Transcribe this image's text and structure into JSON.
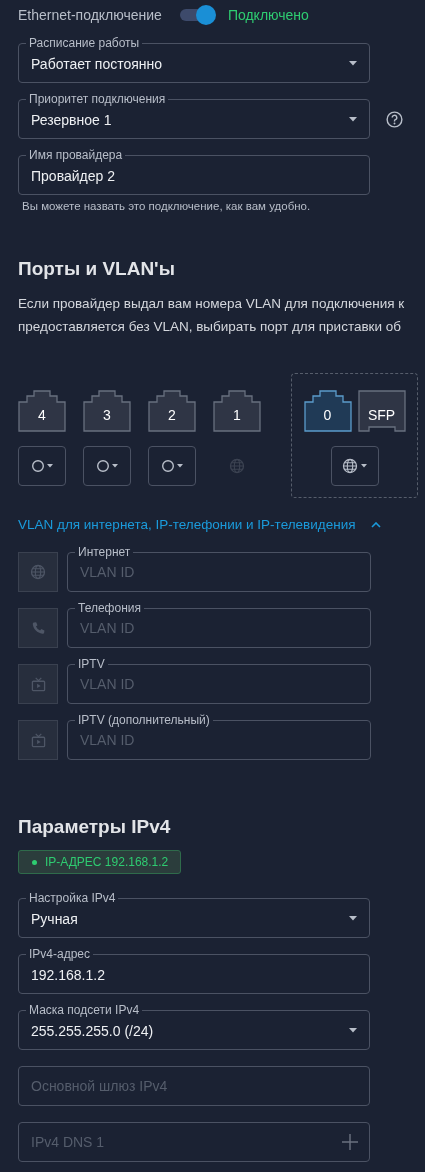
{
  "connection": {
    "label": "Ethernet-подключение",
    "on": true,
    "status": "Подключено"
  },
  "general_fields": [
    {
      "kind": "select",
      "label": "Расписание работы",
      "value": "Работает постоянно",
      "help": false
    },
    {
      "kind": "select",
      "label": "Приоритет подключения",
      "value": "Резервное 1",
      "help": true
    },
    {
      "kind": "text",
      "label": "Имя провайдера",
      "value": "Провайдер 2",
      "help": false
    }
  ],
  "provider_hint": "Вы можете назвать это подключение, как вам удобно.",
  "ports_section": {
    "title": "Порты и VLAN'ы",
    "description": [
      "Если провайдер выдал вам номера VLAN для подключения к",
      "предоставляется без VLAN, выбирать порт для приставки об"
    ],
    "lan_ports": [
      {
        "label": "4",
        "selected": false,
        "kind": "select"
      },
      {
        "label": "3",
        "selected": false,
        "kind": "select"
      },
      {
        "label": "2",
        "selected": false,
        "kind": "select"
      },
      {
        "label": "1",
        "selected": false,
        "kind": "fixed"
      }
    ],
    "wan_ports": [
      {
        "kind": "rj45",
        "label": "0",
        "selected": true
      },
      {
        "kind": "sfp",
        "label": "SFP",
        "selected": false
      }
    ],
    "vlan_toggle": {
      "label": "VLAN для интернета, IP-телефонии и IP-телевидения",
      "expanded": true
    },
    "vlans": [
      {
        "kind": "internet",
        "label": "Интернет",
        "placeholder": "VLAN ID"
      },
      {
        "kind": "phone",
        "label": "Телефония",
        "placeholder": "VLAN ID"
      },
      {
        "kind": "tv",
        "label": "IPTV",
        "placeholder": "VLAN ID"
      },
      {
        "kind": "tv",
        "label": "IPTV (дополнительный)",
        "placeholder": "VLAN ID"
      }
    ]
  },
  "ipv4_section": {
    "title": "Параметры IPv4",
    "badge": {
      "text": "IP-АДРЕС 192.168.1.2",
      "color": "#2ecc71"
    },
    "fields": [
      {
        "kind": "select",
        "label": "Настройка IPv4",
        "value": "Ручная",
        "addable": false
      },
      {
        "kind": "text",
        "label": "IPv4-адрес",
        "value": "192.168.1.2",
        "addable": false
      },
      {
        "kind": "select",
        "label": "Маска подсети IPv4",
        "value": "255.255.255.0 (/24)",
        "addable": false
      },
      {
        "kind": "text",
        "placeholder": "Основной шлюз IPv4",
        "addable": false
      },
      {
        "kind": "text",
        "placeholder": "IPv4 DNS 1",
        "addable": true
      }
    ]
  }
}
